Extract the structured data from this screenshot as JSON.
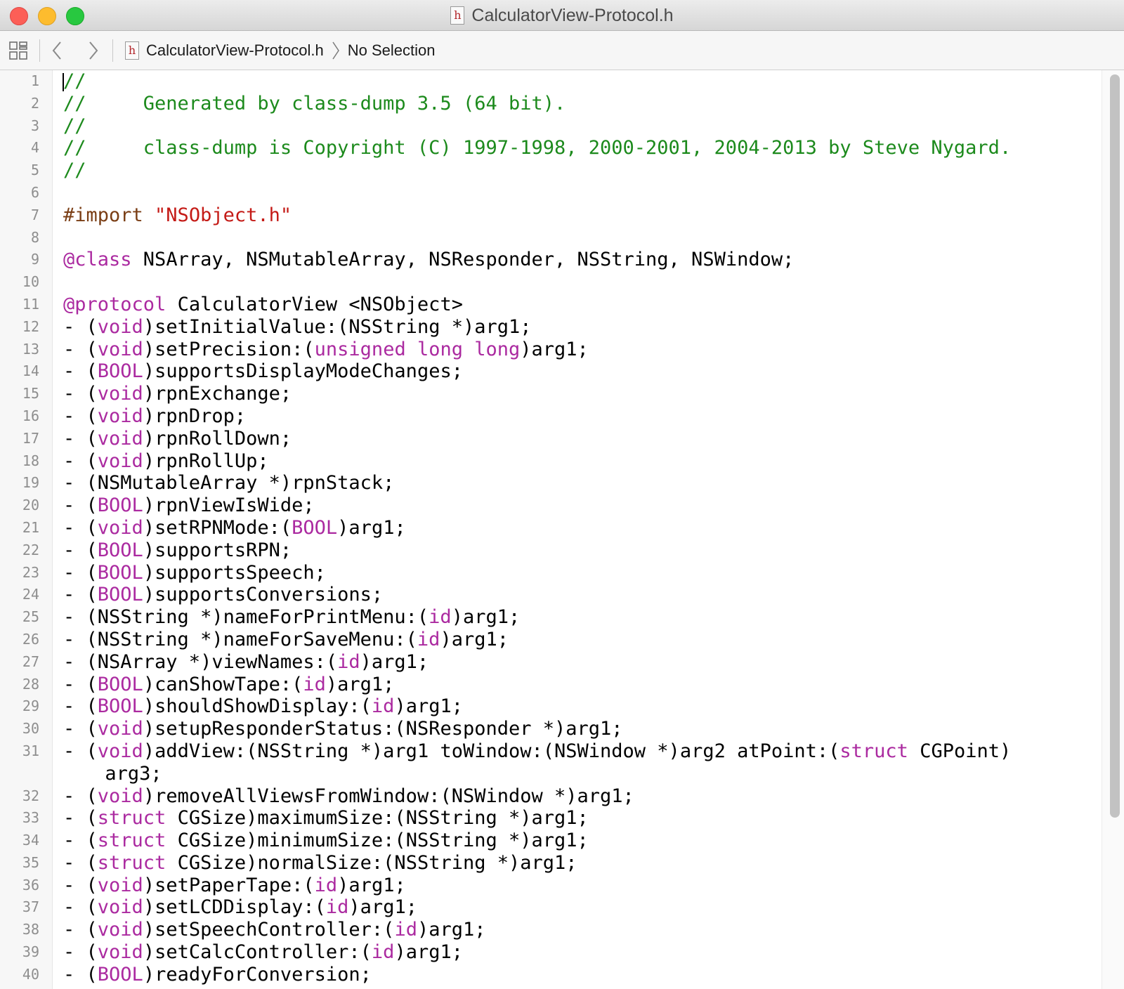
{
  "window": {
    "title": "CalculatorView-Protocol.h",
    "file_icon_glyph": "h"
  },
  "jumpbar": {
    "file_name": "CalculatorView-Protocol.h",
    "selection": "No Selection"
  },
  "colors": {
    "comment": "#1c8a1c",
    "keyword": "#ab2aa0",
    "preprocessor": "#7a3e15",
    "string": "#c41a16",
    "text": "#000000"
  },
  "editor": {
    "lines": [
      {
        "n": "1",
        "tokens": [
          {
            "t": "//",
            "k": "comment"
          }
        ]
      },
      {
        "n": "2",
        "tokens": [
          {
            "t": "//     Generated by class-dump 3.5 (64 bit).",
            "k": "comment"
          }
        ]
      },
      {
        "n": "3",
        "tokens": [
          {
            "t": "//",
            "k": "comment"
          }
        ]
      },
      {
        "n": "4",
        "tokens": [
          {
            "t": "//     class-dump is Copyright (C) 1997-1998, 2000-2001, 2004-2013 by Steve Nygard.",
            "k": "comment"
          }
        ]
      },
      {
        "n": "5",
        "tokens": [
          {
            "t": "//",
            "k": "comment"
          }
        ]
      },
      {
        "n": "6",
        "tokens": []
      },
      {
        "n": "7",
        "tokens": [
          {
            "t": "#import ",
            "k": "pre"
          },
          {
            "t": "\"NSObject.h\"",
            "k": "string"
          }
        ]
      },
      {
        "n": "8",
        "tokens": []
      },
      {
        "n": "9",
        "tokens": [
          {
            "t": "@class",
            "k": "keyword"
          },
          {
            "t": " NSArray, NSMutableArray, NSResponder, NSString, NSWindow;",
            "k": "plain"
          }
        ]
      },
      {
        "n": "10",
        "tokens": []
      },
      {
        "n": "11",
        "tokens": [
          {
            "t": "@protocol",
            "k": "keyword"
          },
          {
            "t": " CalculatorView <NSObject>",
            "k": "plain"
          }
        ]
      },
      {
        "n": "12",
        "tokens": [
          {
            "t": "- (",
            "k": "plain"
          },
          {
            "t": "void",
            "k": "keyword"
          },
          {
            "t": ")setInitialValue:(NSString *)arg1;",
            "k": "plain"
          }
        ]
      },
      {
        "n": "13",
        "tokens": [
          {
            "t": "- (",
            "k": "plain"
          },
          {
            "t": "void",
            "k": "keyword"
          },
          {
            "t": ")setPrecision:(",
            "k": "plain"
          },
          {
            "t": "unsigned long long",
            "k": "keyword"
          },
          {
            "t": ")arg1;",
            "k": "plain"
          }
        ]
      },
      {
        "n": "14",
        "tokens": [
          {
            "t": "- (",
            "k": "plain"
          },
          {
            "t": "BOOL",
            "k": "keyword"
          },
          {
            "t": ")supportsDisplayModeChanges;",
            "k": "plain"
          }
        ]
      },
      {
        "n": "15",
        "tokens": [
          {
            "t": "- (",
            "k": "plain"
          },
          {
            "t": "void",
            "k": "keyword"
          },
          {
            "t": ")rpnExchange;",
            "k": "plain"
          }
        ]
      },
      {
        "n": "16",
        "tokens": [
          {
            "t": "- (",
            "k": "plain"
          },
          {
            "t": "void",
            "k": "keyword"
          },
          {
            "t": ")rpnDrop;",
            "k": "plain"
          }
        ]
      },
      {
        "n": "17",
        "tokens": [
          {
            "t": "- (",
            "k": "plain"
          },
          {
            "t": "void",
            "k": "keyword"
          },
          {
            "t": ")rpnRollDown;",
            "k": "plain"
          }
        ]
      },
      {
        "n": "18",
        "tokens": [
          {
            "t": "- (",
            "k": "plain"
          },
          {
            "t": "void",
            "k": "keyword"
          },
          {
            "t": ")rpnRollUp;",
            "k": "plain"
          }
        ]
      },
      {
        "n": "19",
        "tokens": [
          {
            "t": "- (NSMutableArray *)rpnStack;",
            "k": "plain"
          }
        ]
      },
      {
        "n": "20",
        "tokens": [
          {
            "t": "- (",
            "k": "plain"
          },
          {
            "t": "BOOL",
            "k": "keyword"
          },
          {
            "t": ")rpnViewIsWide;",
            "k": "plain"
          }
        ]
      },
      {
        "n": "21",
        "tokens": [
          {
            "t": "- (",
            "k": "plain"
          },
          {
            "t": "void",
            "k": "keyword"
          },
          {
            "t": ")setRPNMode:(",
            "k": "plain"
          },
          {
            "t": "BOOL",
            "k": "keyword"
          },
          {
            "t": ")arg1;",
            "k": "plain"
          }
        ]
      },
      {
        "n": "22",
        "tokens": [
          {
            "t": "- (",
            "k": "plain"
          },
          {
            "t": "BOOL",
            "k": "keyword"
          },
          {
            "t": ")supportsRPN;",
            "k": "plain"
          }
        ]
      },
      {
        "n": "23",
        "tokens": [
          {
            "t": "- (",
            "k": "plain"
          },
          {
            "t": "BOOL",
            "k": "keyword"
          },
          {
            "t": ")supportsSpeech;",
            "k": "plain"
          }
        ]
      },
      {
        "n": "24",
        "tokens": [
          {
            "t": "- (",
            "k": "plain"
          },
          {
            "t": "BOOL",
            "k": "keyword"
          },
          {
            "t": ")supportsConversions;",
            "k": "plain"
          }
        ]
      },
      {
        "n": "25",
        "tokens": [
          {
            "t": "- (NSString *)nameForPrintMenu:(",
            "k": "plain"
          },
          {
            "t": "id",
            "k": "keyword"
          },
          {
            "t": ")arg1;",
            "k": "plain"
          }
        ]
      },
      {
        "n": "26",
        "tokens": [
          {
            "t": "- (NSString *)nameForSaveMenu:(",
            "k": "plain"
          },
          {
            "t": "id",
            "k": "keyword"
          },
          {
            "t": ")arg1;",
            "k": "plain"
          }
        ]
      },
      {
        "n": "27",
        "tokens": [
          {
            "t": "- (NSArray *)viewNames:(",
            "k": "plain"
          },
          {
            "t": "id",
            "k": "keyword"
          },
          {
            "t": ")arg1;",
            "k": "plain"
          }
        ]
      },
      {
        "n": "28",
        "tokens": [
          {
            "t": "- (",
            "k": "plain"
          },
          {
            "t": "BOOL",
            "k": "keyword"
          },
          {
            "t": ")canShowTape:(",
            "k": "plain"
          },
          {
            "t": "id",
            "k": "keyword"
          },
          {
            "t": ")arg1;",
            "k": "plain"
          }
        ]
      },
      {
        "n": "29",
        "tokens": [
          {
            "t": "- (",
            "k": "plain"
          },
          {
            "t": "BOOL",
            "k": "keyword"
          },
          {
            "t": ")shouldShowDisplay:(",
            "k": "plain"
          },
          {
            "t": "id",
            "k": "keyword"
          },
          {
            "t": ")arg1;",
            "k": "plain"
          }
        ]
      },
      {
        "n": "30",
        "tokens": [
          {
            "t": "- (",
            "k": "plain"
          },
          {
            "t": "void",
            "k": "keyword"
          },
          {
            "t": ")setupResponderStatus:(NSResponder *)arg1;",
            "k": "plain"
          }
        ]
      },
      {
        "n": "31",
        "wrap": true,
        "tokens": [
          {
            "t": "- (",
            "k": "plain"
          },
          {
            "t": "void",
            "k": "keyword"
          },
          {
            "t": ")addView:(NSString *)arg1 toWindow:(NSWindow *)arg2 atPoint:(",
            "k": "plain"
          },
          {
            "t": "struct",
            "k": "keyword"
          },
          {
            "t": " CGPoint)\narg3;",
            "k": "plain"
          }
        ]
      },
      {
        "n": "32",
        "tokens": [
          {
            "t": "- (",
            "k": "plain"
          },
          {
            "t": "void",
            "k": "keyword"
          },
          {
            "t": ")removeAllViewsFromWindow:(NSWindow *)arg1;",
            "k": "plain"
          }
        ]
      },
      {
        "n": "33",
        "tokens": [
          {
            "t": "- (",
            "k": "plain"
          },
          {
            "t": "struct",
            "k": "keyword"
          },
          {
            "t": " CGSize)maximumSize:(NSString *)arg1;",
            "k": "plain"
          }
        ]
      },
      {
        "n": "34",
        "tokens": [
          {
            "t": "- (",
            "k": "plain"
          },
          {
            "t": "struct",
            "k": "keyword"
          },
          {
            "t": " CGSize)minimumSize:(NSString *)arg1;",
            "k": "plain"
          }
        ]
      },
      {
        "n": "35",
        "tokens": [
          {
            "t": "- (",
            "k": "plain"
          },
          {
            "t": "struct",
            "k": "keyword"
          },
          {
            "t": " CGSize)normalSize:(NSString *)arg1;",
            "k": "plain"
          }
        ]
      },
      {
        "n": "36",
        "tokens": [
          {
            "t": "- (",
            "k": "plain"
          },
          {
            "t": "void",
            "k": "keyword"
          },
          {
            "t": ")setPaperTape:(",
            "k": "plain"
          },
          {
            "t": "id",
            "k": "keyword"
          },
          {
            "t": ")arg1;",
            "k": "plain"
          }
        ]
      },
      {
        "n": "37",
        "tokens": [
          {
            "t": "- (",
            "k": "plain"
          },
          {
            "t": "void",
            "k": "keyword"
          },
          {
            "t": ")setLCDDisplay:(",
            "k": "plain"
          },
          {
            "t": "id",
            "k": "keyword"
          },
          {
            "t": ")arg1;",
            "k": "plain"
          }
        ]
      },
      {
        "n": "38",
        "tokens": [
          {
            "t": "- (",
            "k": "plain"
          },
          {
            "t": "void",
            "k": "keyword"
          },
          {
            "t": ")setSpeechController:(",
            "k": "plain"
          },
          {
            "t": "id",
            "k": "keyword"
          },
          {
            "t": ")arg1;",
            "k": "plain"
          }
        ]
      },
      {
        "n": "39",
        "tokens": [
          {
            "t": "- (",
            "k": "plain"
          },
          {
            "t": "void",
            "k": "keyword"
          },
          {
            "t": ")setCalcController:(",
            "k": "plain"
          },
          {
            "t": "id",
            "k": "keyword"
          },
          {
            "t": ")arg1;",
            "k": "plain"
          }
        ]
      },
      {
        "n": "40",
        "tokens": [
          {
            "t": "- (",
            "k": "plain"
          },
          {
            "t": "BOOL",
            "k": "keyword"
          },
          {
            "t": ")readyForConversion;",
            "k": "plain"
          }
        ]
      }
    ]
  }
}
